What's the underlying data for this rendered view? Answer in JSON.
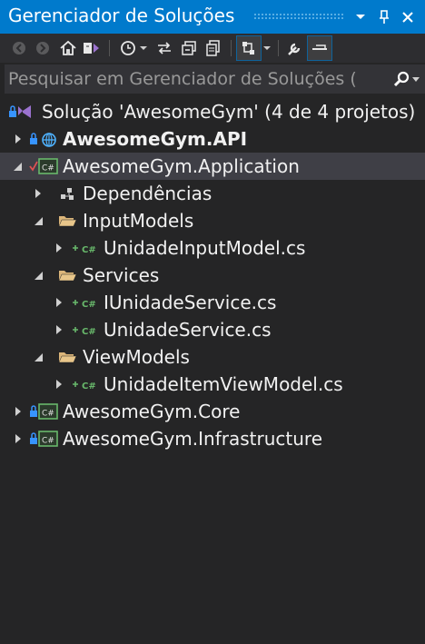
{
  "window": {
    "title": "Gerenciador de Soluções",
    "accent_color": "#007acc",
    "title_buttons": [
      "chevron-down-icon",
      "pin-icon",
      "close-icon"
    ]
  },
  "toolbar": {
    "icons": [
      "back-icon",
      "forward-icon",
      "home-icon",
      "solution-switch-icon",
      "history-icon",
      "sync-icon",
      "collapse-all-icon",
      "show-all-files-icon",
      "pending-changes-filter-icon",
      "properties-icon",
      "preview-icon"
    ]
  },
  "search": {
    "placeholder": "Pesquisar em Gerenciador de Soluções (",
    "value": ""
  },
  "tree": {
    "solution": "Solução 'AwesomeGym' (4 de 4 projetos)",
    "api": "AwesomeGym.API",
    "application": "AwesomeGym.Application",
    "dependencies": "Dependências",
    "input_models": "InputModels",
    "unidade_input_model": "UnidadeInputModel.cs",
    "services": "Services",
    "iunidade_service": "IUnidadeService.cs",
    "unidade_service": "UnidadeService.cs",
    "view_models": "ViewModels",
    "unidade_item_view_model": "UnidadeItemViewModel.cs",
    "core": "AwesomeGym.Core",
    "infrastructure": "AwesomeGym.Infrastructure"
  }
}
